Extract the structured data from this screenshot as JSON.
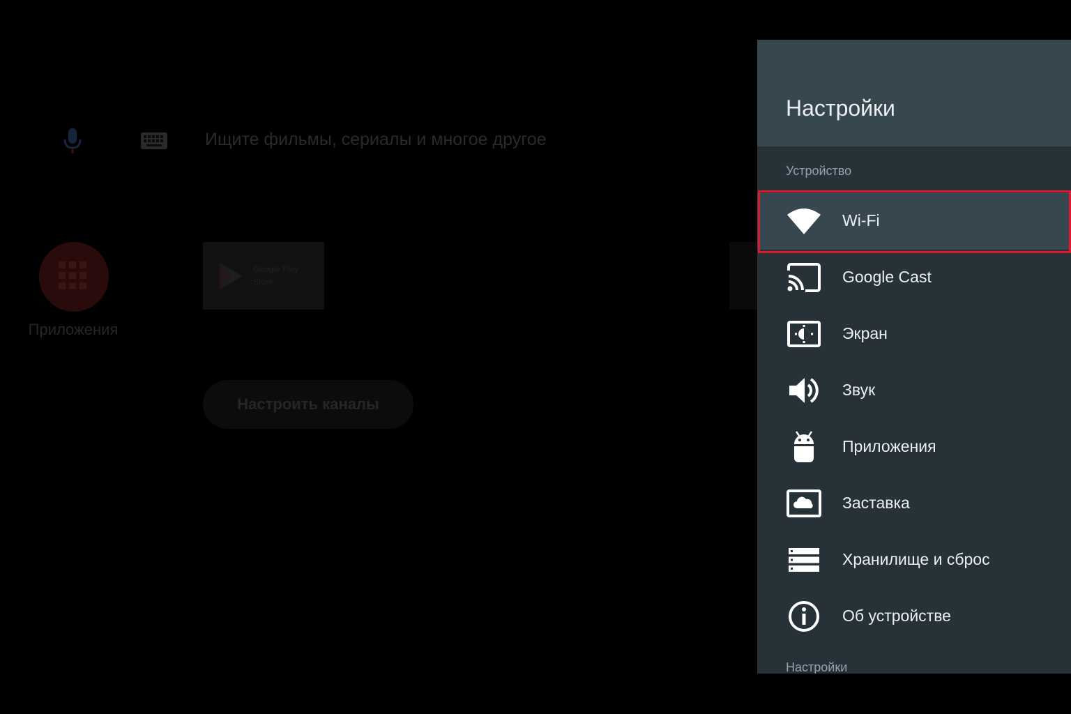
{
  "home": {
    "search_placeholder": "Ищите фильмы, сериалы и многое другое",
    "apps_label": "Приложения",
    "play_store_label": "Google Play Store",
    "setup_channels_label": "Настроить каналы"
  },
  "settings": {
    "title": "Настройки",
    "section_device": "Устройство",
    "section_settings": "Настройки",
    "items": [
      {
        "label": "Wi-Fi",
        "icon": "wifi-icon",
        "selected": true
      },
      {
        "label": "Google Cast",
        "icon": "cast-icon",
        "selected": false
      },
      {
        "label": "Экран",
        "icon": "display-icon",
        "selected": false
      },
      {
        "label": "Звук",
        "icon": "volume-icon",
        "selected": false
      },
      {
        "label": "Приложения",
        "icon": "android-icon",
        "selected": false
      },
      {
        "label": "Заставка",
        "icon": "screensaver-icon",
        "selected": false
      },
      {
        "label": "Хранилище и сброс",
        "icon": "storage-icon",
        "selected": false
      },
      {
        "label": "Об устройстве",
        "icon": "info-icon",
        "selected": false
      }
    ]
  },
  "colors": {
    "panel_bg": "#263238",
    "panel_header_bg": "#37474f",
    "selected_row_bg": "#37474f",
    "highlight_border": "#e0192e"
  }
}
